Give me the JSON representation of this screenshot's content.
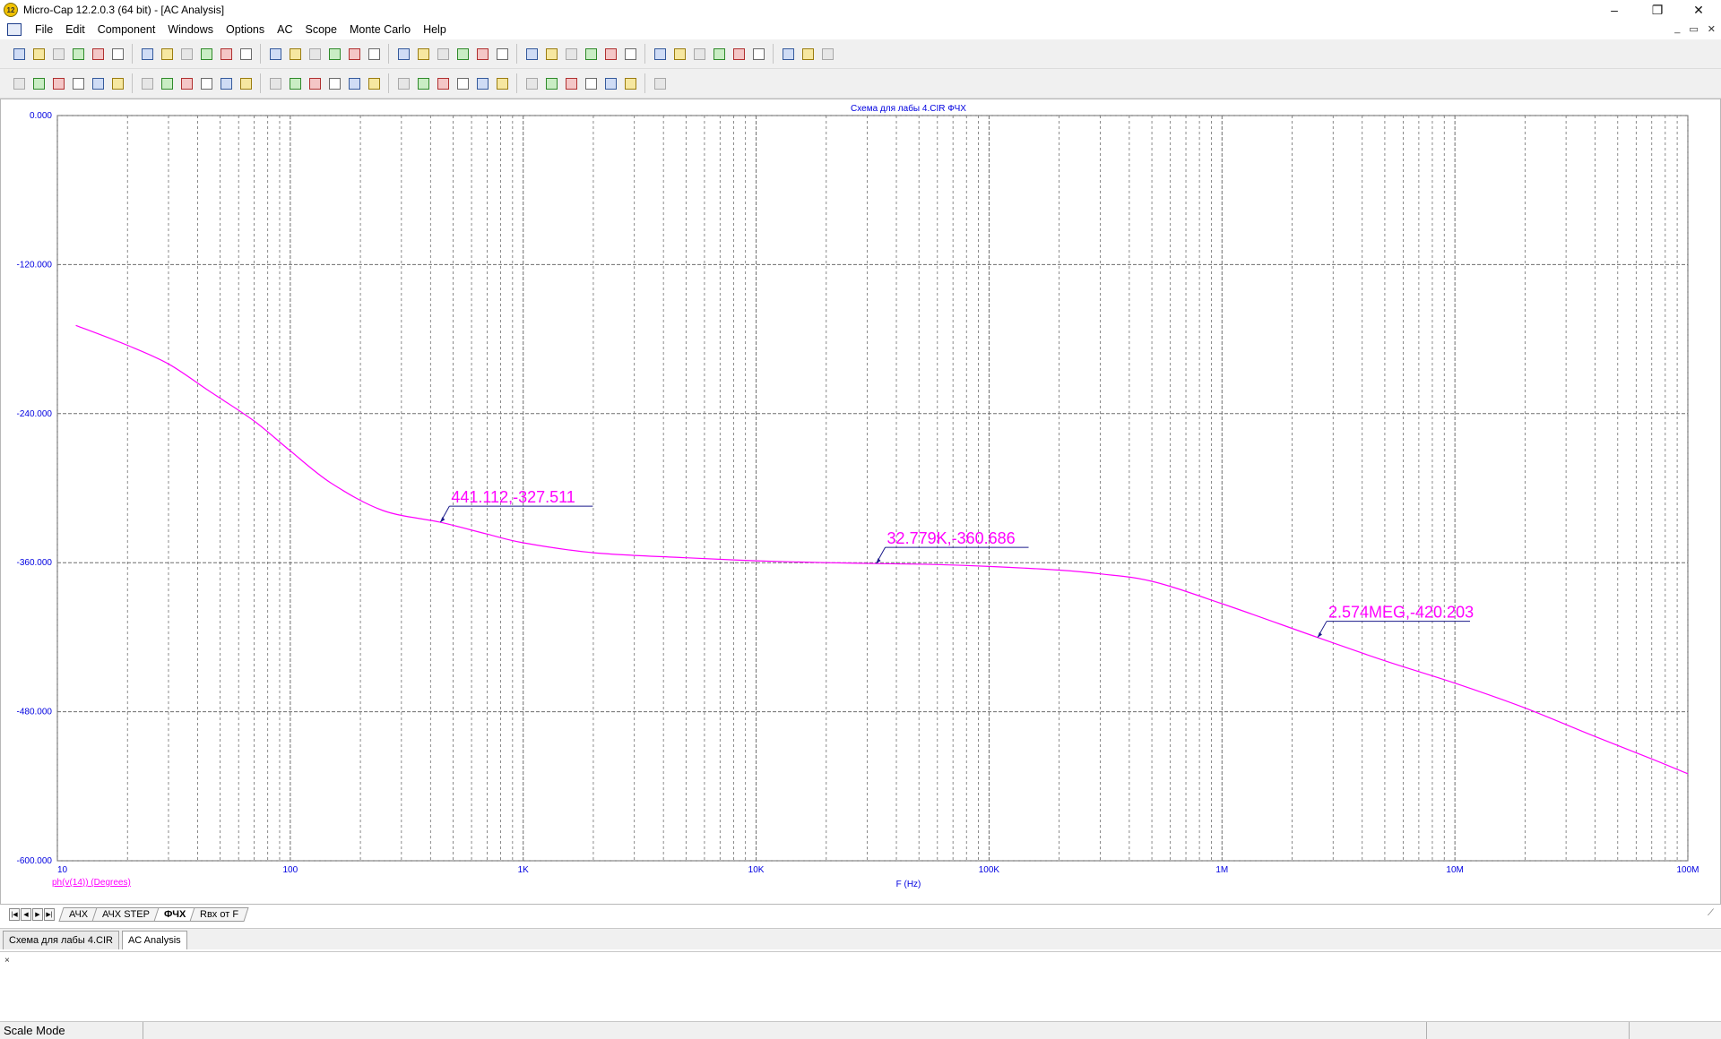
{
  "window": {
    "title": "Micro-Cap 12.2.0.3 (64 bit) - [AC Analysis]",
    "minimize": "–",
    "restore": "❐",
    "close": "✕",
    "mdi_minimize": "_",
    "mdi_restore": "▭",
    "mdi_close": "✕"
  },
  "menu": {
    "items": [
      "File",
      "Edit",
      "Component",
      "Windows",
      "Options",
      "AC",
      "Scope",
      "Monte Carlo",
      "Help"
    ]
  },
  "toolbar1": {
    "icons": [
      "new-file-icon",
      "open-file-icon",
      "save-icon",
      "save-all-icon",
      "print-preview-icon",
      "print-icon",
      "undo-icon",
      "redo-icon",
      "cut-icon",
      "copy-icon",
      "paste-icon",
      "delete-icon",
      "select-all-icon",
      "ground-icon",
      "resistor-icon",
      "capacitor-icon",
      "inductor-icon",
      "diode-icon",
      "battery-icon",
      "transistor-icon",
      "opamp-icon",
      "macro-icon",
      "wire-icon",
      "junction-icon",
      "cascade-icon",
      "tile-horizontal-icon",
      "tile-vertical-icon",
      "window-icon",
      "calculator-icon",
      "page-icon",
      "component-editor-icon",
      "globe-icon",
      "properties-icon",
      "model-icon",
      "shape-editor-icon",
      "package-editor-icon",
      "tools-icon",
      "analysis-icon",
      "settings-icon"
    ]
  },
  "toolbar2": {
    "icons": [
      "pointer-icon",
      "pan-icon",
      "zoom-icon",
      "scale-icon",
      "cursor-mode-icon",
      "text-icon",
      "run-icon",
      "stop-icon",
      "pause-icon",
      "step-icon",
      "peak-icon",
      "valley-icon",
      "high-icon",
      "low-icon",
      "inflection-icon",
      "go-to-x-icon",
      "go-to-y-icon",
      "go-to-branch-icon",
      "tag-left-icon",
      "tag-right-icon",
      "tag-horizontal-icon",
      "tag-vertical-icon",
      "performance-tag-icon",
      "data-point-icon",
      "zoom-in-icon",
      "zoom-out-icon",
      "auto-scale-icon",
      "grid-icon",
      "font-icon",
      "color-icon",
      "align-icon"
    ]
  },
  "plot": {
    "title": "Схема для лабы 4.CIR ФЧХ",
    "x_axis_label": "F (Hz)",
    "y_axis_label": "ph(v(14)) (Degrees)",
    "curve_color": "#ff00ff",
    "grid_color": "#6e6e6e",
    "axis_text_color": "#0000e0",
    "tags": [
      {
        "text": "441.112,-327.511",
        "x": 441.112,
        "y": -327.511
      },
      {
        "text": "32.779K,-360.686",
        "x": 32779,
        "y": -360.686
      },
      {
        "text": "2.574MEG,-420.203",
        "x": 2574000,
        "y": -420.203
      }
    ]
  },
  "chart_data": {
    "type": "line",
    "title": "Схема для лабы 4.CIR ФЧХ",
    "xlabel": "F (Hz)",
    "ylabel": "ph(v(14)) (Degrees)",
    "xscale": "log",
    "xlim": [
      10,
      100000000
    ],
    "ylim": [
      -600,
      0
    ],
    "x_ticks": [
      {
        "value": 10,
        "label": "10"
      },
      {
        "value": 100,
        "label": "100"
      },
      {
        "value": 1000,
        "label": "1K"
      },
      {
        "value": 10000,
        "label": "10K"
      },
      {
        "value": 100000,
        "label": "100K"
      },
      {
        "value": 1000000,
        "label": "1M"
      },
      {
        "value": 10000000,
        "label": "10M"
      },
      {
        "value": 100000000,
        "label": "100M"
      }
    ],
    "y_ticks": [
      {
        "value": 0,
        "label": "0.000"
      },
      {
        "value": -120,
        "label": "-120.000"
      },
      {
        "value": -240,
        "label": "-240.000"
      },
      {
        "value": -360,
        "label": "-360.000"
      },
      {
        "value": -480,
        "label": "-480.000"
      },
      {
        "value": -600,
        "label": "-600.000"
      }
    ],
    "grid": true,
    "series": [
      {
        "name": "ph(v(14)) (Degrees)",
        "x": [
          12,
          20,
          30,
          45,
          70,
          100,
          150,
          250,
          441,
          700,
          1000,
          2000,
          5000,
          10000,
          20000,
          32779,
          60000,
          100000,
          200000,
          300000,
          500000,
          1000000,
          2574000,
          5000000,
          10000000,
          20000000,
          40000000,
          70000000,
          100000000
        ],
        "y": [
          -169,
          -185,
          -200,
          -222,
          -246,
          -270,
          -296,
          -318,
          -327.5,
          -337,
          -344,
          -352,
          -356,
          -358.5,
          -360,
          -360.686,
          -361.5,
          -363,
          -366,
          -369,
          -375,
          -393,
          -420.203,
          -439,
          -457,
          -477,
          -500,
          -518,
          -530
        ]
      }
    ]
  },
  "sheet_tabs": {
    "nav": [
      "|◀",
      "◀",
      "▶",
      "▶|"
    ],
    "tabs": [
      "АЧХ",
      "АЧХ STEP",
      "ФЧХ",
      "Rвх от F"
    ],
    "active": "ФЧХ"
  },
  "file_tabs": {
    "tabs": [
      "Схема для лабы 4.CIR",
      "AC Analysis"
    ],
    "active": "AC Analysis"
  },
  "output": {
    "close": "×"
  },
  "status": {
    "mode": "Scale Mode"
  }
}
